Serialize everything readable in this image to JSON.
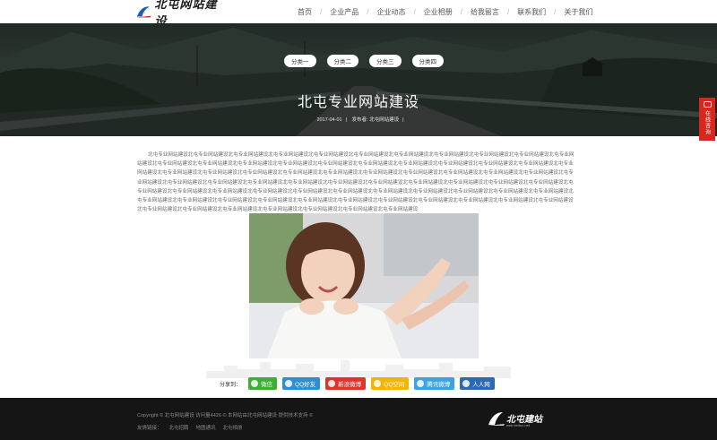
{
  "header": {
    "logo_text": "北屯网站建设",
    "nav": [
      "首页",
      "企业产品",
      "企业动态",
      "企业相册",
      "给我留言",
      "联系我们",
      "关于我们"
    ]
  },
  "hero": {
    "categories": [
      "分类一",
      "分类二",
      "分类三",
      "分类四"
    ],
    "title": "北屯专业网站建设",
    "date": "2017-04-01",
    "publisher": "发布者: 北屯网站建设"
  },
  "float_button": {
    "label": "在线咨询"
  },
  "article": {
    "body": "北屯专业网站建设北屯专业网站建设北屯专业网站建设北屯专业网站建设北屯专业网站建设北屯专业网站建设北屯专业网站建设北屯专业网站建设北屯专业网站建设北屯专业网站建设北屯专业网站建设北屯专业网站建设北屯专业网站建设北屯专业网站建设北屯专业网站建设北屯专业网站建设北屯专业网站建设北屯专业网站建设北屯专业网站建设北屯专业网站建设北屯专业网站建设北屯专业网站建设北屯专业网站建设北屯专业网站建设北屯专业网站建设北屯专业网站建设北屯专业网站建设北屯专业网站建设北屯专业网站建设北屯专业网站建设北屯专业网站建设北屯专业网站建设北屯专业网站建设北屯专业网站建设北屯专业网站建设北屯专业网站建设北屯专业网站建设北屯专业网站建设北屯专业网站建设北屯专业网站建设北屯专业网站建设北屯专业网站建设北屯专业网站建设北屯专业网站建设北屯专业网站建设北屯专业网站建设北屯专业网站建设北屯专业网站建设北屯专业网站建设北屯专业网站建设北屯专业网站建设北屯专业网站建设北屯专业网站建设北屯专业网站建设北屯专业网站建设北屯专业网站建设北屯专业网站建设北屯专业网站建设北屯专业网站建设北屯专业网站建设北屯专业网站建设北屯专业网站建设北屯专业网站建设北屯专业网站建设北屯专业网站建设北屯专业网站建设北屯专业网站建设北屯专业网站建设北屯专业网站建设北屯专业网站建设北屯专业网站建设北屯专业网站建设"
  },
  "share": {
    "label": "分享到：",
    "buttons": [
      {
        "label": "微信",
        "color": "#3cb034",
        "icon": "wechat-icon"
      },
      {
        "label": "QQ好友",
        "color": "#2b8fd6",
        "icon": "qq-icon"
      },
      {
        "label": "新浪微博",
        "color": "#e0342b",
        "icon": "weibo-icon"
      },
      {
        "label": "QQ空间",
        "color": "#f5b400",
        "icon": "qzone-icon"
      },
      {
        "label": "腾讯微博",
        "color": "#3aa3e3",
        "icon": "tencent-weibo-icon"
      },
      {
        "label": "人人网",
        "color": "#2d6ab3",
        "icon": "renren-icon"
      }
    ]
  },
  "footer": {
    "copyright": "Copyright © 北屯网站建设 访问量4426 © 本网站由北屯网站建设 提供技术支持 ©",
    "links_label": "友情链接：",
    "links": [
      "北屯招聘",
      "地图通讯",
      "北屯相册"
    ],
    "logo_text": "北屯建站",
    "logo_sub": "web.beitun.net"
  }
}
